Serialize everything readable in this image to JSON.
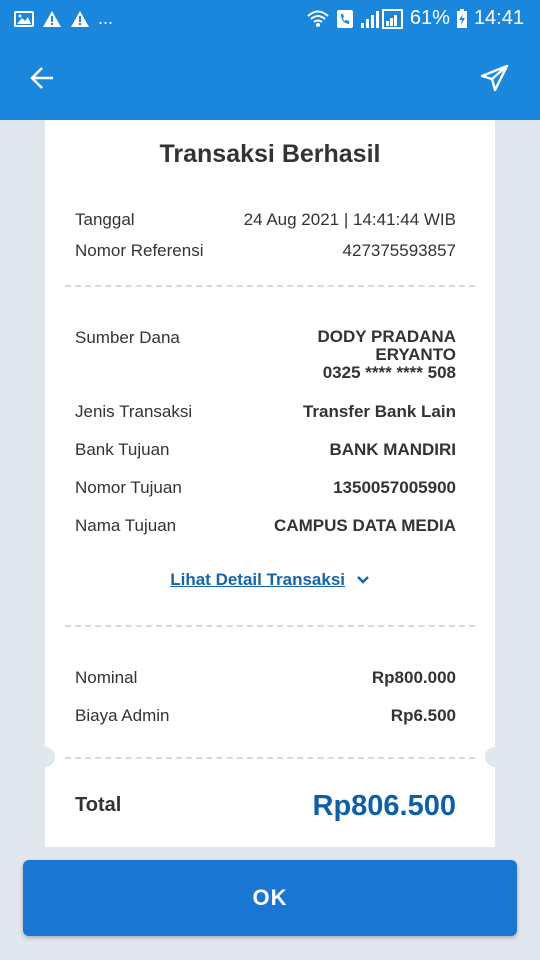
{
  "status_bar": {
    "dots": "...",
    "battery": "61%",
    "time": "14:41"
  },
  "receipt": {
    "title": "Transaksi Berhasil",
    "tanggal_label": "Tanggal",
    "tanggal_value": "24 Aug 2021 | 14:41:44 WIB",
    "referensi_label": "Nomor Referensi",
    "referensi_value": "427375593857",
    "sumber_label": "Sumber Dana",
    "sumber_name_line1": "DODY PRADANA",
    "sumber_name_line2": "ERYANTO",
    "sumber_account": "0325 **** **** 508",
    "jenis_label": "Jenis Transaksi",
    "jenis_value": "Transfer Bank Lain",
    "bank_label": "Bank Tujuan",
    "bank_value": "BANK MANDIRI",
    "nomor_tujuan_label": "Nomor Tujuan",
    "nomor_tujuan_value": "1350057005900",
    "nama_tujuan_label": "Nama Tujuan",
    "nama_tujuan_value": "CAMPUS DATA MEDIA",
    "detail_link": "Lihat Detail Transaksi",
    "nominal_label": "Nominal",
    "nominal_value": "Rp800.000",
    "admin_label": "Biaya Admin",
    "admin_value": "Rp6.500",
    "total_label": "Total",
    "total_value": "Rp806.500"
  },
  "ok_button": "OK",
  "colors": {
    "primary": "#1a87dc",
    "button": "#1976d2",
    "total": "#0e5ea8",
    "link": "#1565a8",
    "background": "#e1e7ee"
  }
}
